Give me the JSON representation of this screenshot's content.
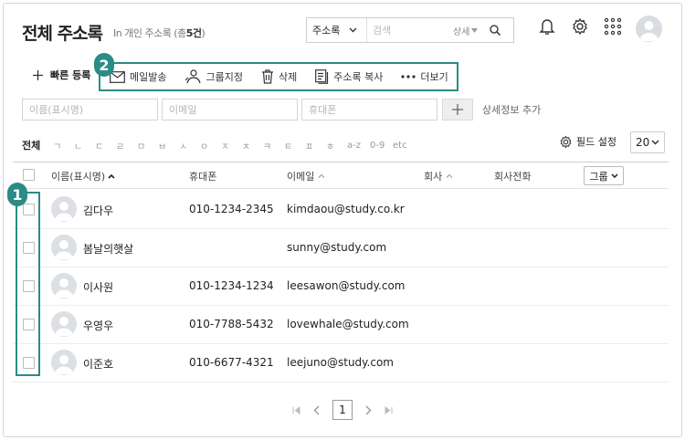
{
  "header": {
    "title": "전체 주소록",
    "subtitle_prefix": "In 개인 주소록 (총",
    "subtitle_count": "5건",
    "subtitle_suffix": ")"
  },
  "search": {
    "scope": "주소록",
    "placeholder": "검색",
    "detail_label": "상세"
  },
  "toolbar": {
    "quick_add": "빠른 등록",
    "mail": "메일발송",
    "group_assign": "그룹지정",
    "delete": "삭제",
    "copy": "주소록 복사",
    "more": "더보기"
  },
  "badges": {
    "one": "1",
    "two": "2"
  },
  "quick_fields": {
    "name_placeholder": "이름(표시명)",
    "email_placeholder": "이메일",
    "phone_placeholder": "휴대폰",
    "add_detail": "상세정보 추가"
  },
  "alpha_filter": [
    "전체",
    "ㄱ",
    "ㄴ",
    "ㄷ",
    "ㄹ",
    "ㅁ",
    "ㅂ",
    "ㅅ",
    "ㅇ",
    "ㅈ",
    "ㅊ",
    "ㅋ",
    "ㅌ",
    "ㅍ",
    "ㅎ",
    "a-z",
    "0-9",
    "etc"
  ],
  "field_setting": "필드 설정",
  "per_page": "20",
  "columns": {
    "name": "이름(표시명)",
    "phone": "휴대폰",
    "email": "이메일",
    "company": "회사",
    "company_phone": "회사전화",
    "group": "그룹"
  },
  "rows": [
    {
      "name": "김다우",
      "phone": "010-1234-2345",
      "email": "kimdaou@study.co.kr"
    },
    {
      "name": "봄날의햇살",
      "phone": "",
      "email": "sunny@study.com"
    },
    {
      "name": "이사원",
      "phone": "010-1234-1234",
      "email": "leesawon@study.com"
    },
    {
      "name": "우영우",
      "phone": "010-7788-5432",
      "email": "lovewhale@study.com"
    },
    {
      "name": "이준호",
      "phone": "010-6677-4321",
      "email": "leejuno@study.com"
    }
  ],
  "pagination": {
    "current": "1"
  },
  "colors": {
    "accent": "#2a8b87"
  }
}
